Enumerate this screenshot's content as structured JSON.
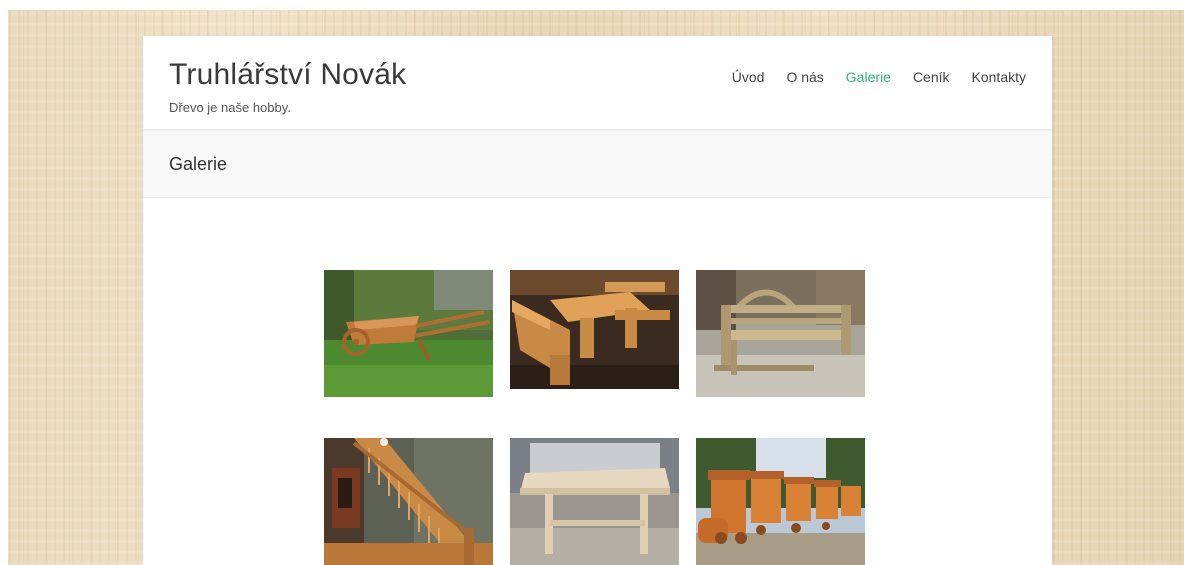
{
  "site": {
    "title": "Truhlářství Novák",
    "description": "Dřevo je naše hobby."
  },
  "nav": {
    "items": [
      {
        "label": "Úvod"
      },
      {
        "label": "O nás"
      },
      {
        "label": "Galerie",
        "active": true
      },
      {
        "label": "Ceník"
      },
      {
        "label": "Kontakty"
      }
    ]
  },
  "page": {
    "title": "Galerie"
  },
  "gallery": {
    "images": [
      {
        "subject": "wooden-wheelbarrow"
      },
      {
        "subject": "wooden-table-with-benches"
      },
      {
        "subject": "wooden-garden-bench"
      },
      {
        "subject": "wooden-staircase"
      },
      {
        "subject": "wooden-table"
      },
      {
        "subject": "wooden-toy-train"
      }
    ]
  },
  "colors": {
    "accent": "#36b37e",
    "text": "#444444",
    "wood": "#c98a45"
  }
}
